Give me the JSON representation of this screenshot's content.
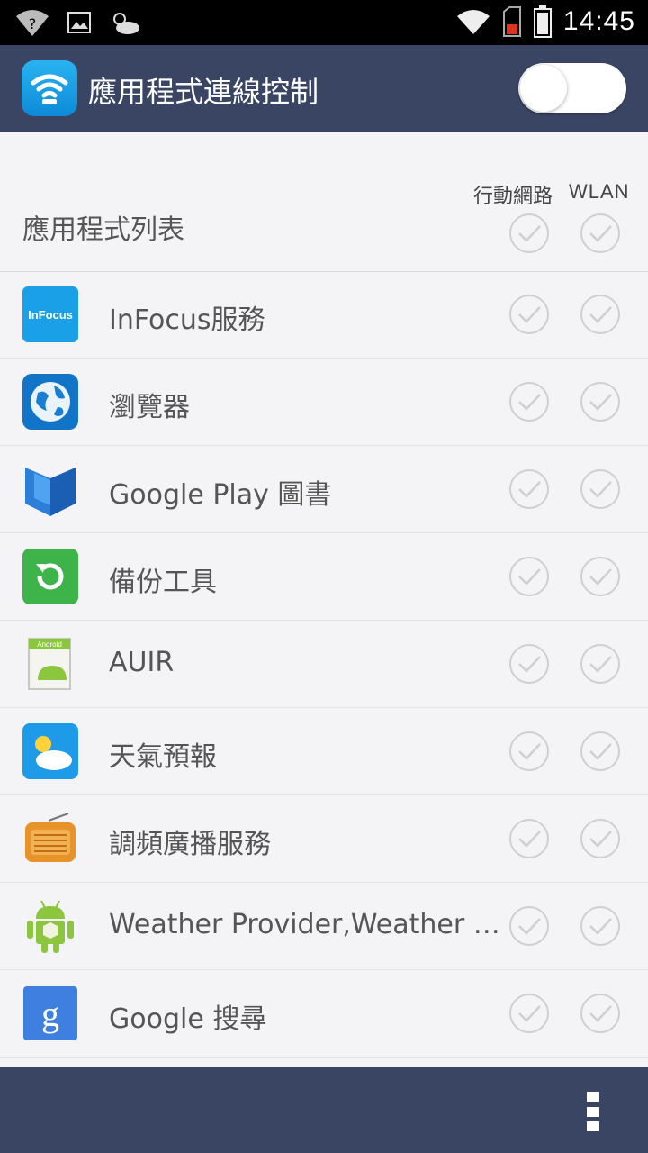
{
  "status_bar": {
    "time": "14:45"
  },
  "app_bar": {
    "title": "應用程式連線控制",
    "master_toggle_on": false
  },
  "list_header": {
    "title": "應用程式列表",
    "col_mobile": "行動網路",
    "col_wlan": "WLAN"
  },
  "apps": [
    {
      "name": "InFocus服務",
      "icon": "infocus-icon",
      "icon_text": "InFocus"
    },
    {
      "name": "瀏覽器",
      "icon": "browser-globe-icon"
    },
    {
      "name": "Google Play 圖書",
      "icon": "play-books-icon"
    },
    {
      "name": "備份工具",
      "icon": "backup-icon"
    },
    {
      "name": "AUIR",
      "icon": "android-box-icon",
      "icon_text": "Android"
    },
    {
      "name": "天氣預報",
      "icon": "weather-icon"
    },
    {
      "name": "調頻廣播服務",
      "icon": "radio-icon"
    },
    {
      "name": "Weather Provider,Weather Se...",
      "icon": "android-robot-icon"
    },
    {
      "name": "Google 搜尋",
      "icon": "google-search-icon",
      "icon_text": "g"
    }
  ],
  "colors": {
    "bar": "#3a4564",
    "check": "#cfcfd3"
  }
}
